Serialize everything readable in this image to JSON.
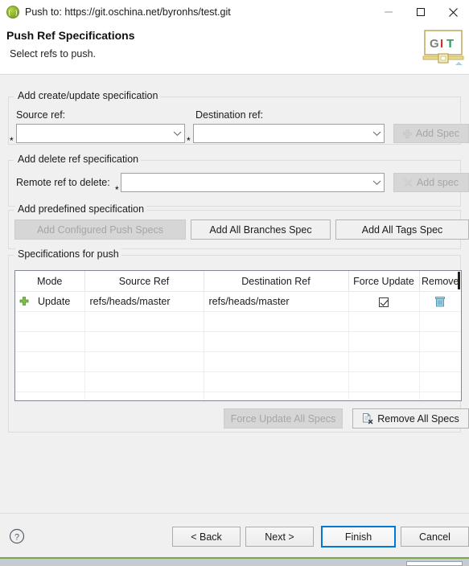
{
  "window": {
    "icon": "git-repo-icon",
    "title": "Push to: https://git.oschina.net/byronhs/test.git",
    "minimize_label": "minimize-icon",
    "maximize_label": "maximize-icon",
    "close_label": "close-icon"
  },
  "header": {
    "title": "Push Ref Specifications",
    "subtitle": "Select refs to push.",
    "logo_letters": [
      "G",
      "I",
      "T"
    ],
    "logo_colors": [
      "#808080",
      "#c0392b",
      "#27a05a"
    ]
  },
  "create_update_group": {
    "legend": "Add create/update specification",
    "source_label": "Source ref:",
    "source_value": "",
    "source_required_marker": "*",
    "destination_label": "Destination ref:",
    "destination_value": "",
    "destination_required_marker": "*",
    "add_spec_button": "Add Spec",
    "add_spec_enabled": false
  },
  "delete_group": {
    "legend": "Add delete ref specification",
    "remote_label": "Remote ref to delete:",
    "remote_value": "",
    "remote_required_marker": "*",
    "add_spec_button": "Add spec",
    "add_spec_enabled": false
  },
  "predefined_group": {
    "legend": "Add predefined specification",
    "buttons": [
      {
        "label": "Add Configured Push Specs",
        "enabled": false
      },
      {
        "label": "Add All Branches Spec",
        "enabled": true
      },
      {
        "label": "Add All Tags Spec",
        "enabled": true
      }
    ]
  },
  "specifications_group": {
    "legend": "Specifications for push",
    "columns": [
      "Mode",
      "Source Ref",
      "Destination Ref",
      "Force Update",
      "Remove"
    ],
    "rows": [
      {
        "mode": "Update",
        "mode_icon": "add-plus-icon",
        "source_ref": "refs/heads/master",
        "destination_ref": "refs/heads/master",
        "force_update": true,
        "remove_icon": "trash-icon"
      }
    ],
    "empty_row_count": 5,
    "footer_buttons": [
      {
        "label": "Force Update All Specs",
        "enabled": false,
        "icon": ""
      },
      {
        "label": "Remove All Specs",
        "enabled": true,
        "icon": "remove-document-icon"
      }
    ]
  },
  "footer": {
    "help_icon": "help-icon",
    "buttons": [
      {
        "label": "< Back",
        "default": false
      },
      {
        "label": "Next >",
        "default": false
      },
      {
        "label": "Finish",
        "default": true
      },
      {
        "label": "Cancel",
        "default": false
      }
    ],
    "accent_color": "#0078d7"
  }
}
